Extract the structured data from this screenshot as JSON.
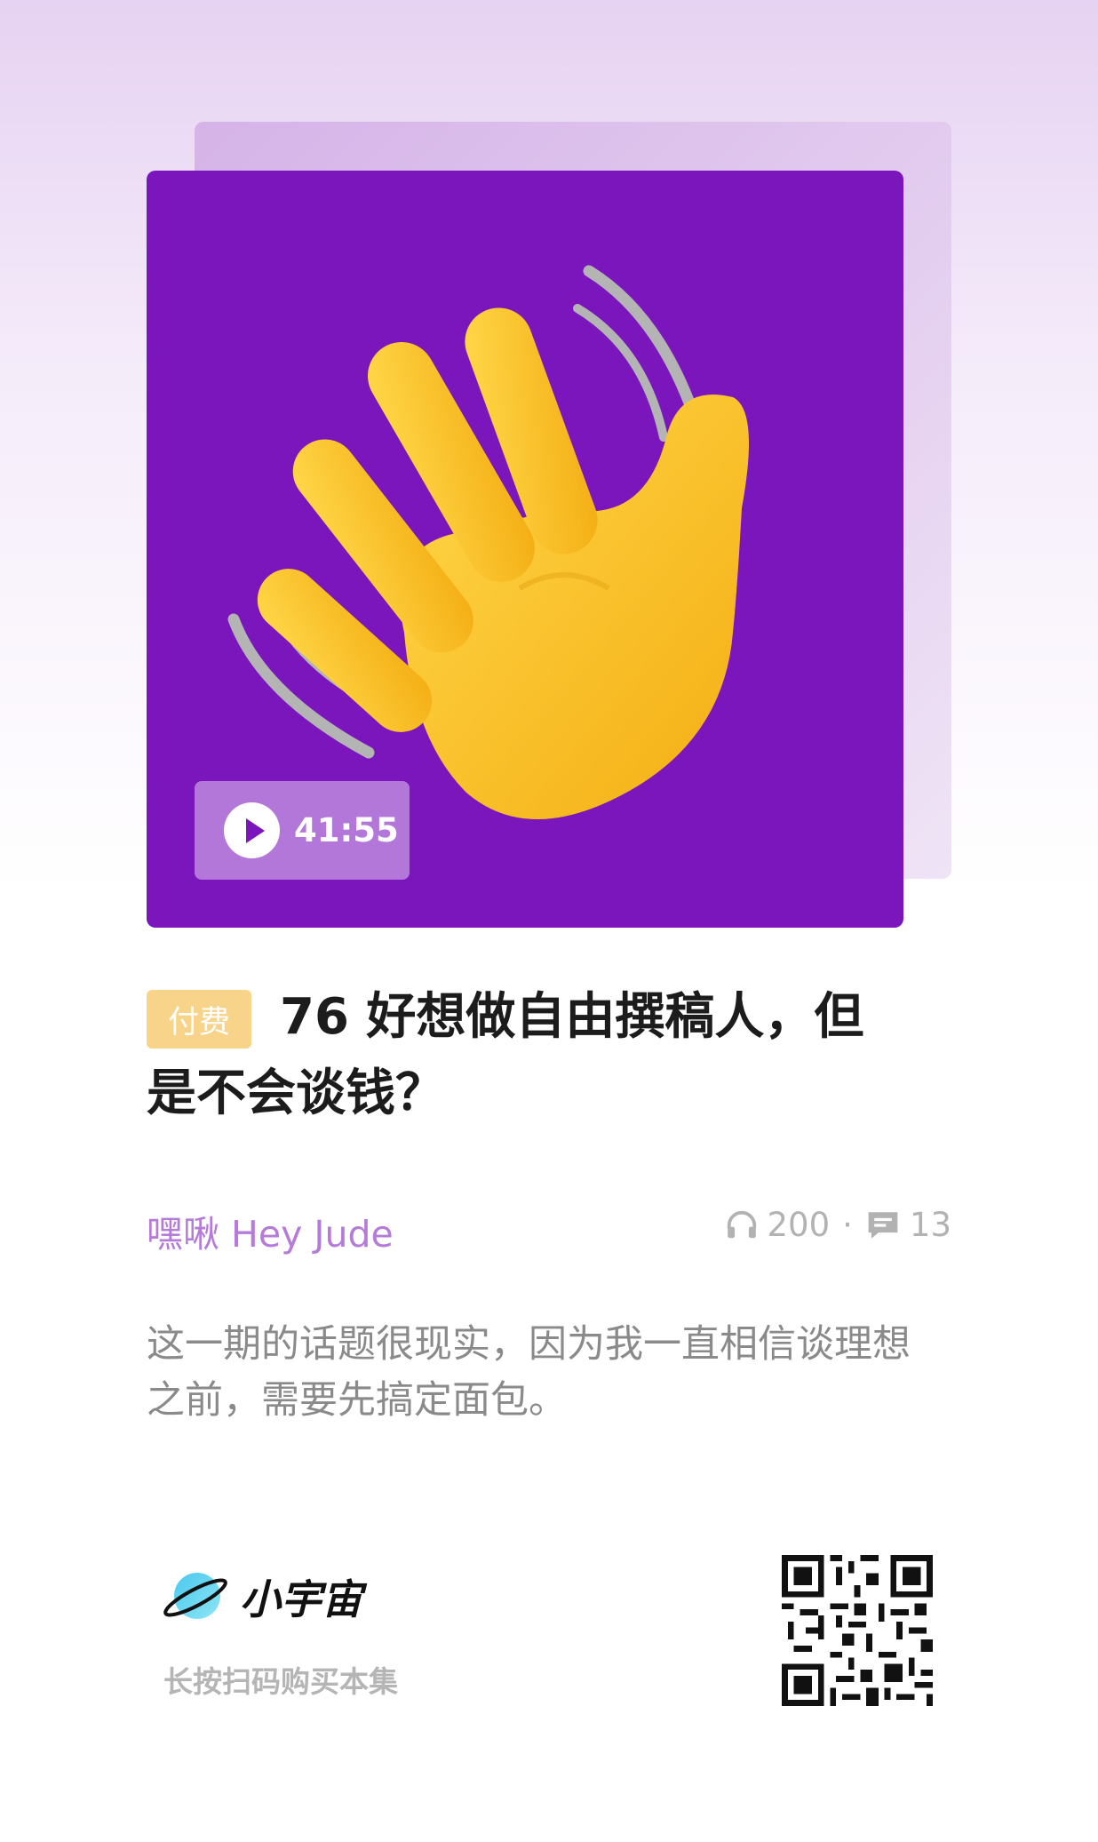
{
  "cover": {
    "duration": "41:55",
    "icons": {
      "play": "play-icon",
      "art": "waving-hand-icon"
    }
  },
  "episode": {
    "badge": "付费",
    "title": "76 好想做自由撰稿人，但是不会谈钱？",
    "author": "嘿啾 Hey Jude",
    "plays": "200",
    "separator": "·",
    "comments": "13",
    "description": "这一期的话题很现实，因为我一直相信谈理想之前，需要先搞定面包。"
  },
  "footer": {
    "brand": "小宇宙",
    "cta": "长按扫码购买本集",
    "icons": {
      "logo": "planet-logo-icon",
      "qr": "qr-code"
    }
  },
  "colors": {
    "cover_bg": "#7b16bd",
    "accent": "#b57bd9",
    "paid_badge": "#f8d48b"
  }
}
